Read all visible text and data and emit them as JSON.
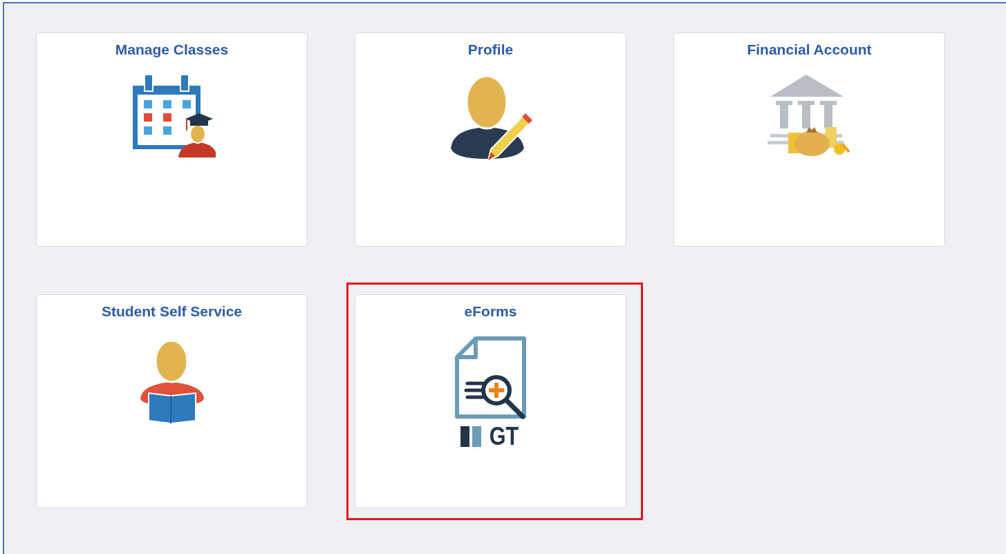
{
  "tiles": [
    {
      "title": "Manage Classes",
      "kind": "calendar",
      "highlighted": false
    },
    {
      "title": "Profile",
      "kind": "profile",
      "highlighted": false
    },
    {
      "title": "Financial Account",
      "kind": "bank",
      "highlighted": false
    },
    {
      "title": "Student Self Service",
      "kind": "reader",
      "highlighted": false
    },
    {
      "title": "eForms",
      "kind": "eforms",
      "logo_text": "GT",
      "highlighted": true
    }
  ]
}
